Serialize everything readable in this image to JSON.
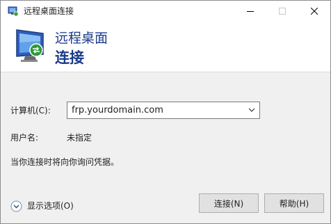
{
  "window": {
    "title": "远程桌面连接"
  },
  "banner": {
    "line1": "远程桌面",
    "line2": "连接"
  },
  "form": {
    "computer_label": "计算机(C):",
    "computer_value": "frp.yourdomain.com",
    "user_label": "用户名:",
    "user_value": "未指定",
    "hint": "当你连接时将向你询问凭据。"
  },
  "footer": {
    "options_label": "显示选项(O)",
    "connect_label": "连接(N)",
    "help_label": "帮助(H)"
  },
  "colors": {
    "banner_title": "#1a3a8a",
    "window_bg": "#f0f0f0"
  },
  "icons": {
    "app": "remote-desktop-icon",
    "banner": "remote-desktop-large-icon",
    "options": "expand-chevron-icon",
    "combo": "chevron-down-icon"
  }
}
